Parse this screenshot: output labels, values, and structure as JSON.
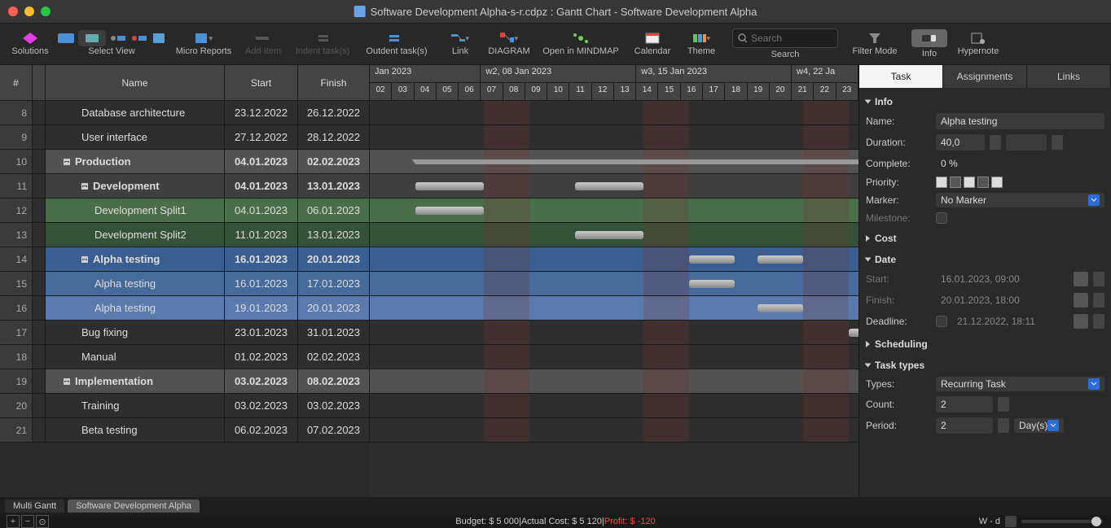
{
  "window": {
    "title": "Software Development Alpha-s-r.cdpz : Gantt Chart - Software Development Alpha"
  },
  "toolbar": {
    "solutions": "Solutions",
    "select_view": "Select View",
    "micro_reports": "Micro Reports",
    "add_item": "Add Item",
    "indent": "Indent task(s)",
    "outdent": "Outdent task(s)",
    "link": "Link",
    "diagram": "DIAGRAM",
    "mindmap": "Open in MINDMAP",
    "calendar": "Calendar",
    "theme": "Theme",
    "search_placeholder": "Search",
    "search_label": "Search",
    "filter": "Filter Mode",
    "info": "Info",
    "hypernote": "Hypernote"
  },
  "grid": {
    "headers": {
      "num": "#",
      "name": "Name",
      "start": "Start",
      "finish": "Finish"
    },
    "rows": [
      {
        "num": "8",
        "name": "Database architecture",
        "start": "23.12.2022",
        "finish": "26.12.2022",
        "cls": "plain",
        "indent": "l2"
      },
      {
        "num": "9",
        "name": "User interface",
        "start": "27.12.2022",
        "finish": "28.12.2022",
        "cls": "plain",
        "indent": "l2"
      },
      {
        "num": "10",
        "name": "Production",
        "start": "04.01.2023",
        "finish": "02.02.2023",
        "cls": "summary",
        "indent": "l1",
        "disc": true
      },
      {
        "num": "11",
        "name": "Development",
        "start": "04.01.2023",
        "finish": "13.01.2023",
        "cls": "group",
        "indent": "l2",
        "disc": true,
        "bold": true
      },
      {
        "num": "12",
        "name": "Development Split1",
        "start": "04.01.2023",
        "finish": "06.01.2023",
        "cls": "dev-green",
        "indent": "l3"
      },
      {
        "num": "13",
        "name": "Development Split2",
        "start": "11.01.2023",
        "finish": "13.01.2023",
        "cls": "dev-dark",
        "indent": "l3"
      },
      {
        "num": "14",
        "name": "Alpha testing",
        "start": "16.01.2023",
        "finish": "20.01.2023",
        "cls": "sel-parent",
        "indent": "l2",
        "disc": true,
        "bold": true
      },
      {
        "num": "15",
        "name": "Alpha testing",
        "start": "16.01.2023",
        "finish": "17.01.2023",
        "cls": "sel-child1",
        "indent": "l3"
      },
      {
        "num": "16",
        "name": "Alpha testing",
        "start": "19.01.2023",
        "finish": "20.01.2023",
        "cls": "sel-child2",
        "indent": "l3"
      },
      {
        "num": "17",
        "name": "Bug fixing",
        "start": "23.01.2023",
        "finish": "31.01.2023",
        "cls": "plain",
        "indent": "l2"
      },
      {
        "num": "18",
        "name": "Manual",
        "start": "01.02.2023",
        "finish": "02.02.2023",
        "cls": "plain",
        "indent": "l2"
      },
      {
        "num": "19",
        "name": "Implementation",
        "start": "03.02.2023",
        "finish": "08.02.2023",
        "cls": "summary",
        "indent": "l1",
        "disc": true
      },
      {
        "num": "20",
        "name": "Training",
        "start": "03.02.2023",
        "finish": "03.02.2023",
        "cls": "plain",
        "indent": "l2"
      },
      {
        "num": "21",
        "name": "Beta testing",
        "start": "06.02.2023",
        "finish": "07.02.2023",
        "cls": "plain",
        "indent": "l2"
      }
    ]
  },
  "gantt": {
    "weeks": [
      {
        "label": "Jan 2023",
        "span": 5
      },
      {
        "label": "w2, 08 Jan 2023",
        "span": 7
      },
      {
        "label": "w3, 15 Jan 2023",
        "span": 7
      },
      {
        "label": "w4, 22 Ja",
        "span": 3
      }
    ],
    "days": [
      "02",
      "03",
      "04",
      "05",
      "06",
      "07",
      "08",
      "09",
      "10",
      "11",
      "12",
      "13",
      "14",
      "15",
      "16",
      "17",
      "18",
      "19",
      "20",
      "21",
      "22",
      "23"
    ]
  },
  "panel": {
    "tabs": {
      "task": "Task",
      "assignments": "Assignments",
      "links": "Links"
    },
    "info": {
      "header": "Info",
      "name_label": "Name:",
      "name": "Alpha testing",
      "duration_label": "Duration:",
      "duration": "40,0",
      "complete_label": "Complete:",
      "complete": "0 %",
      "priority_label": "Priority:",
      "marker_label": "Marker:",
      "marker": "No Marker",
      "milestone_label": "Milestone:"
    },
    "cost": {
      "header": "Cost"
    },
    "date": {
      "header": "Date",
      "start_label": "Start:",
      "start": "16.01.2023, 09:00",
      "finish_label": "Finish:",
      "finish": "20.01.2023, 18:00",
      "deadline_label": "Deadline:",
      "deadline": "21.12.2022, 18:11"
    },
    "scheduling": {
      "header": "Scheduling"
    },
    "tasktypes": {
      "header": "Task types",
      "types_label": "Types:",
      "types": "Recurring Task",
      "count_label": "Count:",
      "count": "2",
      "period_label": "Period:",
      "period": "2",
      "period_unit": "Day(s)"
    }
  },
  "bottom": {
    "multi": "Multi Gantt",
    "project": "Software Development Alpha"
  },
  "status": {
    "budget": "Budget: $ 5 000|Actual Cost: $ 5 120|",
    "profit": "Profit: $ -120",
    "zoom": "W - d"
  }
}
